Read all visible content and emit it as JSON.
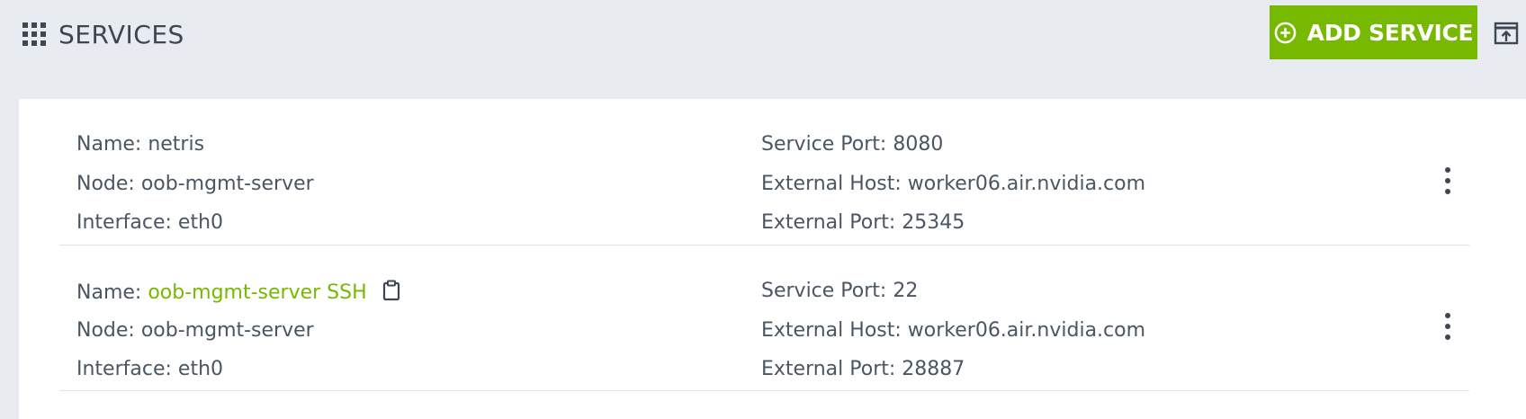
{
  "header": {
    "title": "SERVICES",
    "add_button_label": "ADD SERVICE",
    "icons": {
      "title_icon": "grid-apps-icon",
      "add_icon": "plus-circle-icon",
      "export_icon": "open-external-icon"
    }
  },
  "colors": {
    "accent": "#76b900",
    "background": "#e8ebf0",
    "text": "#4a5663"
  },
  "services": [
    {
      "name_label": "Name:",
      "name": "netris",
      "node_label": "Node:",
      "node": "oob-mgmt-server",
      "interface_label": "Interface:",
      "interface": "eth0",
      "service_port_label": "Service Port:",
      "service_port": "8080",
      "external_host_label": "External Host:",
      "external_host": "worker06.air.nvidia.com",
      "external_port_label": "External Port:",
      "external_port": "25345"
    },
    {
      "name_label": "Name:",
      "name": "oob-mgmt-server SSH",
      "node_label": "Node:",
      "node": "oob-mgmt-server",
      "interface_label": "Interface:",
      "interface": "eth0",
      "service_port_label": "Service Port:",
      "service_port": "22",
      "external_host_label": "External Host:",
      "external_host": "worker06.air.nvidia.com",
      "external_port_label": "External Port:",
      "external_port": "28887"
    }
  ]
}
